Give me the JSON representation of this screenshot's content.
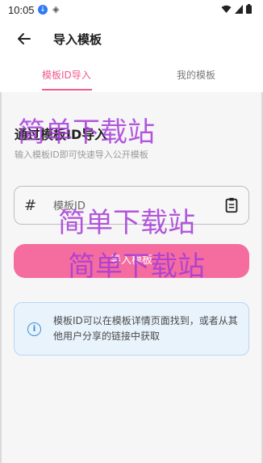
{
  "status_bar": {
    "time": "10:05"
  },
  "app_bar": {
    "title": "导入模板"
  },
  "tabs": [
    {
      "label": "模板ID导入",
      "active": true
    },
    {
      "label": "我的模板",
      "active": false
    }
  ],
  "section": {
    "title": "通过模板ID导入",
    "subtitle": "输入模板ID即可快速导入公开模板"
  },
  "input": {
    "placeholder": "模板ID",
    "value": ""
  },
  "import_button": {
    "label": "导入模板"
  },
  "info": {
    "text": "模板ID可以在模板详情页面找到，或者从其他用户分享的链接中获取"
  },
  "watermark": "简单下载站",
  "colors": {
    "accent": "#f05a8c",
    "button": "#f56d9f",
    "info_bg": "#e9f3fc",
    "info_icon": "#3c8fd8",
    "watermark": "#a63bd8"
  },
  "icons": {
    "back": "arrow-left-icon",
    "hash": "hash-icon",
    "paste": "clipboard-icon",
    "info": "info-icon"
  }
}
